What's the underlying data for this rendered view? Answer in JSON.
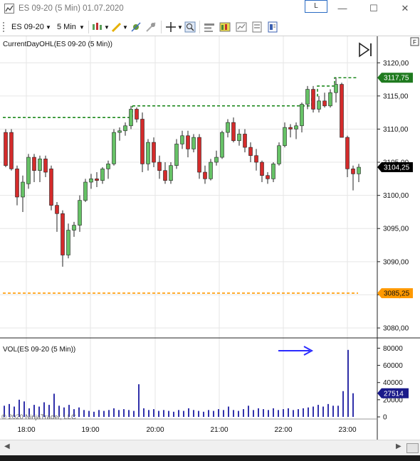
{
  "window": {
    "title": "ES 09-20 (5 Min)  01.07.2020",
    "layout_button": "L",
    "minimize_glyph": "—",
    "maximize_glyph": "☐",
    "close_glyph": "✕"
  },
  "toolbar": {
    "instrument": "ES 09-20",
    "interval": "5 Min",
    "icons": [
      "bar-style-icon",
      "drawing-tool-icon",
      "strategy-icon",
      "indicator-icon",
      "crosshair-icon",
      "zoom-icon",
      "chart-trader-icon",
      "data-box-icon",
      "properties-icon",
      "templates-icon"
    ]
  },
  "panels": {
    "price_label": "CurrentDayOHL(ES 09-20 (5 Min))",
    "volume_label": "VOL(ES 09-20 (5 Min))",
    "copyright": "© 2020 NinjaTrader, LLC",
    "price_scale_icon": "F"
  },
  "chart_data": [
    {
      "type": "candlestick",
      "title": "CurrentDayOHL(ES 09-20 (5 Min))",
      "ylim": [
        3078.5,
        3124
      ],
      "yticks": [
        3080,
        3085,
        3090,
        3095,
        3100,
        3105,
        3110,
        3115,
        3120
      ],
      "ytick_labels": [
        "3080,00",
        "3085,00",
        "3090,00",
        "3095,00",
        "3100,00",
        "3105,00",
        "3110,00",
        "3115,00",
        "3120,00"
      ],
      "xticks": [
        "18:00",
        "19:00",
        "20:00",
        "21:00",
        "22:00",
        "23:00"
      ],
      "candles": [
        {
          "o": 3109.5,
          "h": 3110,
          "l": 3104.25,
          "c": 3104.5
        },
        {
          "o": 3109.5,
          "h": 3110,
          "l": 3103.75,
          "c": 3104
        },
        {
          "o": 3104,
          "h": 3104.5,
          "l": 3098.5,
          "c": 3099.75
        },
        {
          "o": 3099.75,
          "h": 3103,
          "l": 3097.5,
          "c": 3102
        },
        {
          "o": 3101.75,
          "h": 3106.25,
          "l": 3101,
          "c": 3105.75
        },
        {
          "o": 3105.75,
          "h": 3106.25,
          "l": 3102,
          "c": 3103.75
        },
        {
          "o": 3103.75,
          "h": 3106,
          "l": 3102,
          "c": 3105.5
        },
        {
          "o": 3105.5,
          "h": 3106,
          "l": 3102.75,
          "c": 3103.5
        },
        {
          "o": 3104,
          "h": 3104.5,
          "l": 3097.75,
          "c": 3098.5
        },
        {
          "o": 3098.5,
          "h": 3099,
          "l": 3094.5,
          "c": 3097.25
        },
        {
          "o": 3097.25,
          "h": 3097.75,
          "l": 3089.25,
          "c": 3091
        },
        {
          "o": 3091,
          "h": 3095.75,
          "l": 3090.5,
          "c": 3094.75
        },
        {
          "o": 3094.75,
          "h": 3096,
          "l": 3093.75,
          "c": 3095.5
        },
        {
          "o": 3095.5,
          "h": 3100,
          "l": 3094.5,
          "c": 3099.25
        },
        {
          "o": 3099.25,
          "h": 3102.5,
          "l": 3099,
          "c": 3102
        },
        {
          "o": 3102,
          "h": 3103.25,
          "l": 3101,
          "c": 3102.5
        },
        {
          "o": 3102.5,
          "h": 3103.5,
          "l": 3101.25,
          "c": 3102.25
        },
        {
          "o": 3102.25,
          "h": 3104.25,
          "l": 3101.75,
          "c": 3104
        },
        {
          "o": 3104,
          "h": 3105.25,
          "l": 3102.5,
          "c": 3104.75
        },
        {
          "o": 3104.75,
          "h": 3110,
          "l": 3104.5,
          "c": 3109.5
        },
        {
          "o": 3109.5,
          "h": 3110.25,
          "l": 3108.25,
          "c": 3109.75
        },
        {
          "o": 3109.75,
          "h": 3111,
          "l": 3109,
          "c": 3110.5
        },
        {
          "o": 3110.5,
          "h": 3113.5,
          "l": 3110,
          "c": 3113
        },
        {
          "o": 3113,
          "h": 3113.25,
          "l": 3111,
          "c": 3111.5
        },
        {
          "o": 3111.5,
          "h": 3112.5,
          "l": 3103.5,
          "c": 3104.75
        },
        {
          "o": 3104.75,
          "h": 3108.5,
          "l": 3103.75,
          "c": 3108
        },
        {
          "o": 3108,
          "h": 3108.75,
          "l": 3104.25,
          "c": 3105
        },
        {
          "o": 3105,
          "h": 3106,
          "l": 3102.5,
          "c": 3103.75
        },
        {
          "o": 3103.75,
          "h": 3105,
          "l": 3101.75,
          "c": 3102.25
        },
        {
          "o": 3102.25,
          "h": 3105,
          "l": 3101.75,
          "c": 3104.5
        },
        {
          "o": 3104.5,
          "h": 3108.5,
          "l": 3104,
          "c": 3107.75
        },
        {
          "o": 3107.75,
          "h": 3109.75,
          "l": 3107,
          "c": 3109
        },
        {
          "o": 3109,
          "h": 3109.75,
          "l": 3105.75,
          "c": 3107
        },
        {
          "o": 3107,
          "h": 3109.25,
          "l": 3106.5,
          "c": 3108.75
        },
        {
          "o": 3108.75,
          "h": 3109.25,
          "l": 3102.5,
          "c": 3103.5
        },
        {
          "o": 3103.5,
          "h": 3104.5,
          "l": 3101.75,
          "c": 3102.5
        },
        {
          "o": 3102.5,
          "h": 3105.5,
          "l": 3102.25,
          "c": 3105
        },
        {
          "o": 3105,
          "h": 3106.75,
          "l": 3104.5,
          "c": 3105.75
        },
        {
          "o": 3105.75,
          "h": 3109.75,
          "l": 3105.5,
          "c": 3109.5
        },
        {
          "o": 3109.5,
          "h": 3111.5,
          "l": 3108.75,
          "c": 3111
        },
        {
          "o": 3111,
          "h": 3111.75,
          "l": 3108,
          "c": 3108.25
        },
        {
          "o": 3108.25,
          "h": 3110,
          "l": 3107.5,
          "c": 3109.25
        },
        {
          "o": 3109.25,
          "h": 3110,
          "l": 3106.5,
          "c": 3107.25
        },
        {
          "o": 3107.25,
          "h": 3108,
          "l": 3105,
          "c": 3106
        },
        {
          "o": 3106,
          "h": 3107,
          "l": 3103.75,
          "c": 3105
        },
        {
          "o": 3105,
          "h": 3105.25,
          "l": 3102,
          "c": 3103
        },
        {
          "o": 3103,
          "h": 3103.5,
          "l": 3101.75,
          "c": 3102.5
        },
        {
          "o": 3102.5,
          "h": 3105,
          "l": 3102,
          "c": 3104.75
        },
        {
          "o": 3104.75,
          "h": 3108,
          "l": 3104.5,
          "c": 3107.5
        },
        {
          "o": 3107.5,
          "h": 3111,
          "l": 3107.25,
          "c": 3110.25
        },
        {
          "o": 3110.25,
          "h": 3110.75,
          "l": 3108.75,
          "c": 3110
        },
        {
          "o": 3110,
          "h": 3111,
          "l": 3108.5,
          "c": 3110.5
        },
        {
          "o": 3110.5,
          "h": 3114,
          "l": 3109.5,
          "c": 3113.75
        },
        {
          "o": 3113.75,
          "h": 3116.5,
          "l": 3113,
          "c": 3116
        },
        {
          "o": 3116,
          "h": 3116.5,
          "l": 3112.5,
          "c": 3113
        },
        {
          "o": 3113,
          "h": 3115,
          "l": 3112.5,
          "c": 3114.25
        },
        {
          "o": 3114.25,
          "h": 3115.5,
          "l": 3113.25,
          "c": 3113.5
        },
        {
          "o": 3113.5,
          "h": 3116,
          "l": 3113.25,
          "c": 3115.5
        },
        {
          "o": 3115.5,
          "h": 3117.75,
          "l": 3114,
          "c": 3116.75
        },
        {
          "o": 3116.75,
          "h": 3117,
          "l": 3109,
          "c": 3108.75
        },
        {
          "o": 3108.75,
          "h": 3109,
          "l": 3102.75,
          "c": 3104
        },
        {
          "o": 3104,
          "h": 3104.5,
          "l": 3100.75,
          "c": 3103.25
        },
        {
          "o": 3103.25,
          "h": 3104.75,
          "l": 3102,
          "c": 3104.25
        }
      ],
      "current_day_high": 3113.5,
      "current_day_high_late": 3117.75,
      "current_day_low": 3085.25,
      "prior_high": 3111.75,
      "price_markers": [
        {
          "label": "3117,75",
          "value": 3117.75,
          "color": "#1f7a1f"
        },
        {
          "label": "3104,25",
          "value": 3104.25,
          "color": "#000000"
        },
        {
          "label": "3085,25",
          "value": 3085.25,
          "color": "#ff9900"
        }
      ],
      "up_color": "#66c266",
      "down_color": "#d42b2b"
    },
    {
      "type": "bar",
      "title": "VOL(ES 09-20 (5 Min))",
      "ylim": [
        0,
        82000
      ],
      "yticks": [
        0,
        20000,
        40000,
        60000,
        80000
      ],
      "ytick_labels": [
        "0",
        "20000",
        "40000",
        "60000",
        "80000"
      ],
      "values": [
        13000,
        15000,
        12000,
        20000,
        18000,
        10000,
        14000,
        12000,
        17000,
        14000,
        27000,
        13000,
        11000,
        14000,
        9000,
        11000,
        8000,
        7000,
        6000,
        8000,
        7000,
        8000,
        10000,
        8000,
        9000,
        8000,
        7000,
        38000,
        10000,
        8000,
        9000,
        7000,
        8000,
        7000,
        6000,
        8000,
        7000,
        10000,
        8000,
        7000,
        6000,
        8000,
        7000,
        9000,
        8000,
        12000,
        8000,
        7000,
        9000,
        13000,
        8000,
        10000,
        9000,
        8000,
        10000,
        8000,
        9000,
        10000,
        8000,
        9000,
        10000,
        11000,
        12000,
        14000,
        12000,
        15000,
        13000,
        13000,
        30000,
        78000,
        27514
      ],
      "color": "#1a1aa0",
      "current_label": "27514",
      "annotation": "arrow pointing right"
    }
  ]
}
